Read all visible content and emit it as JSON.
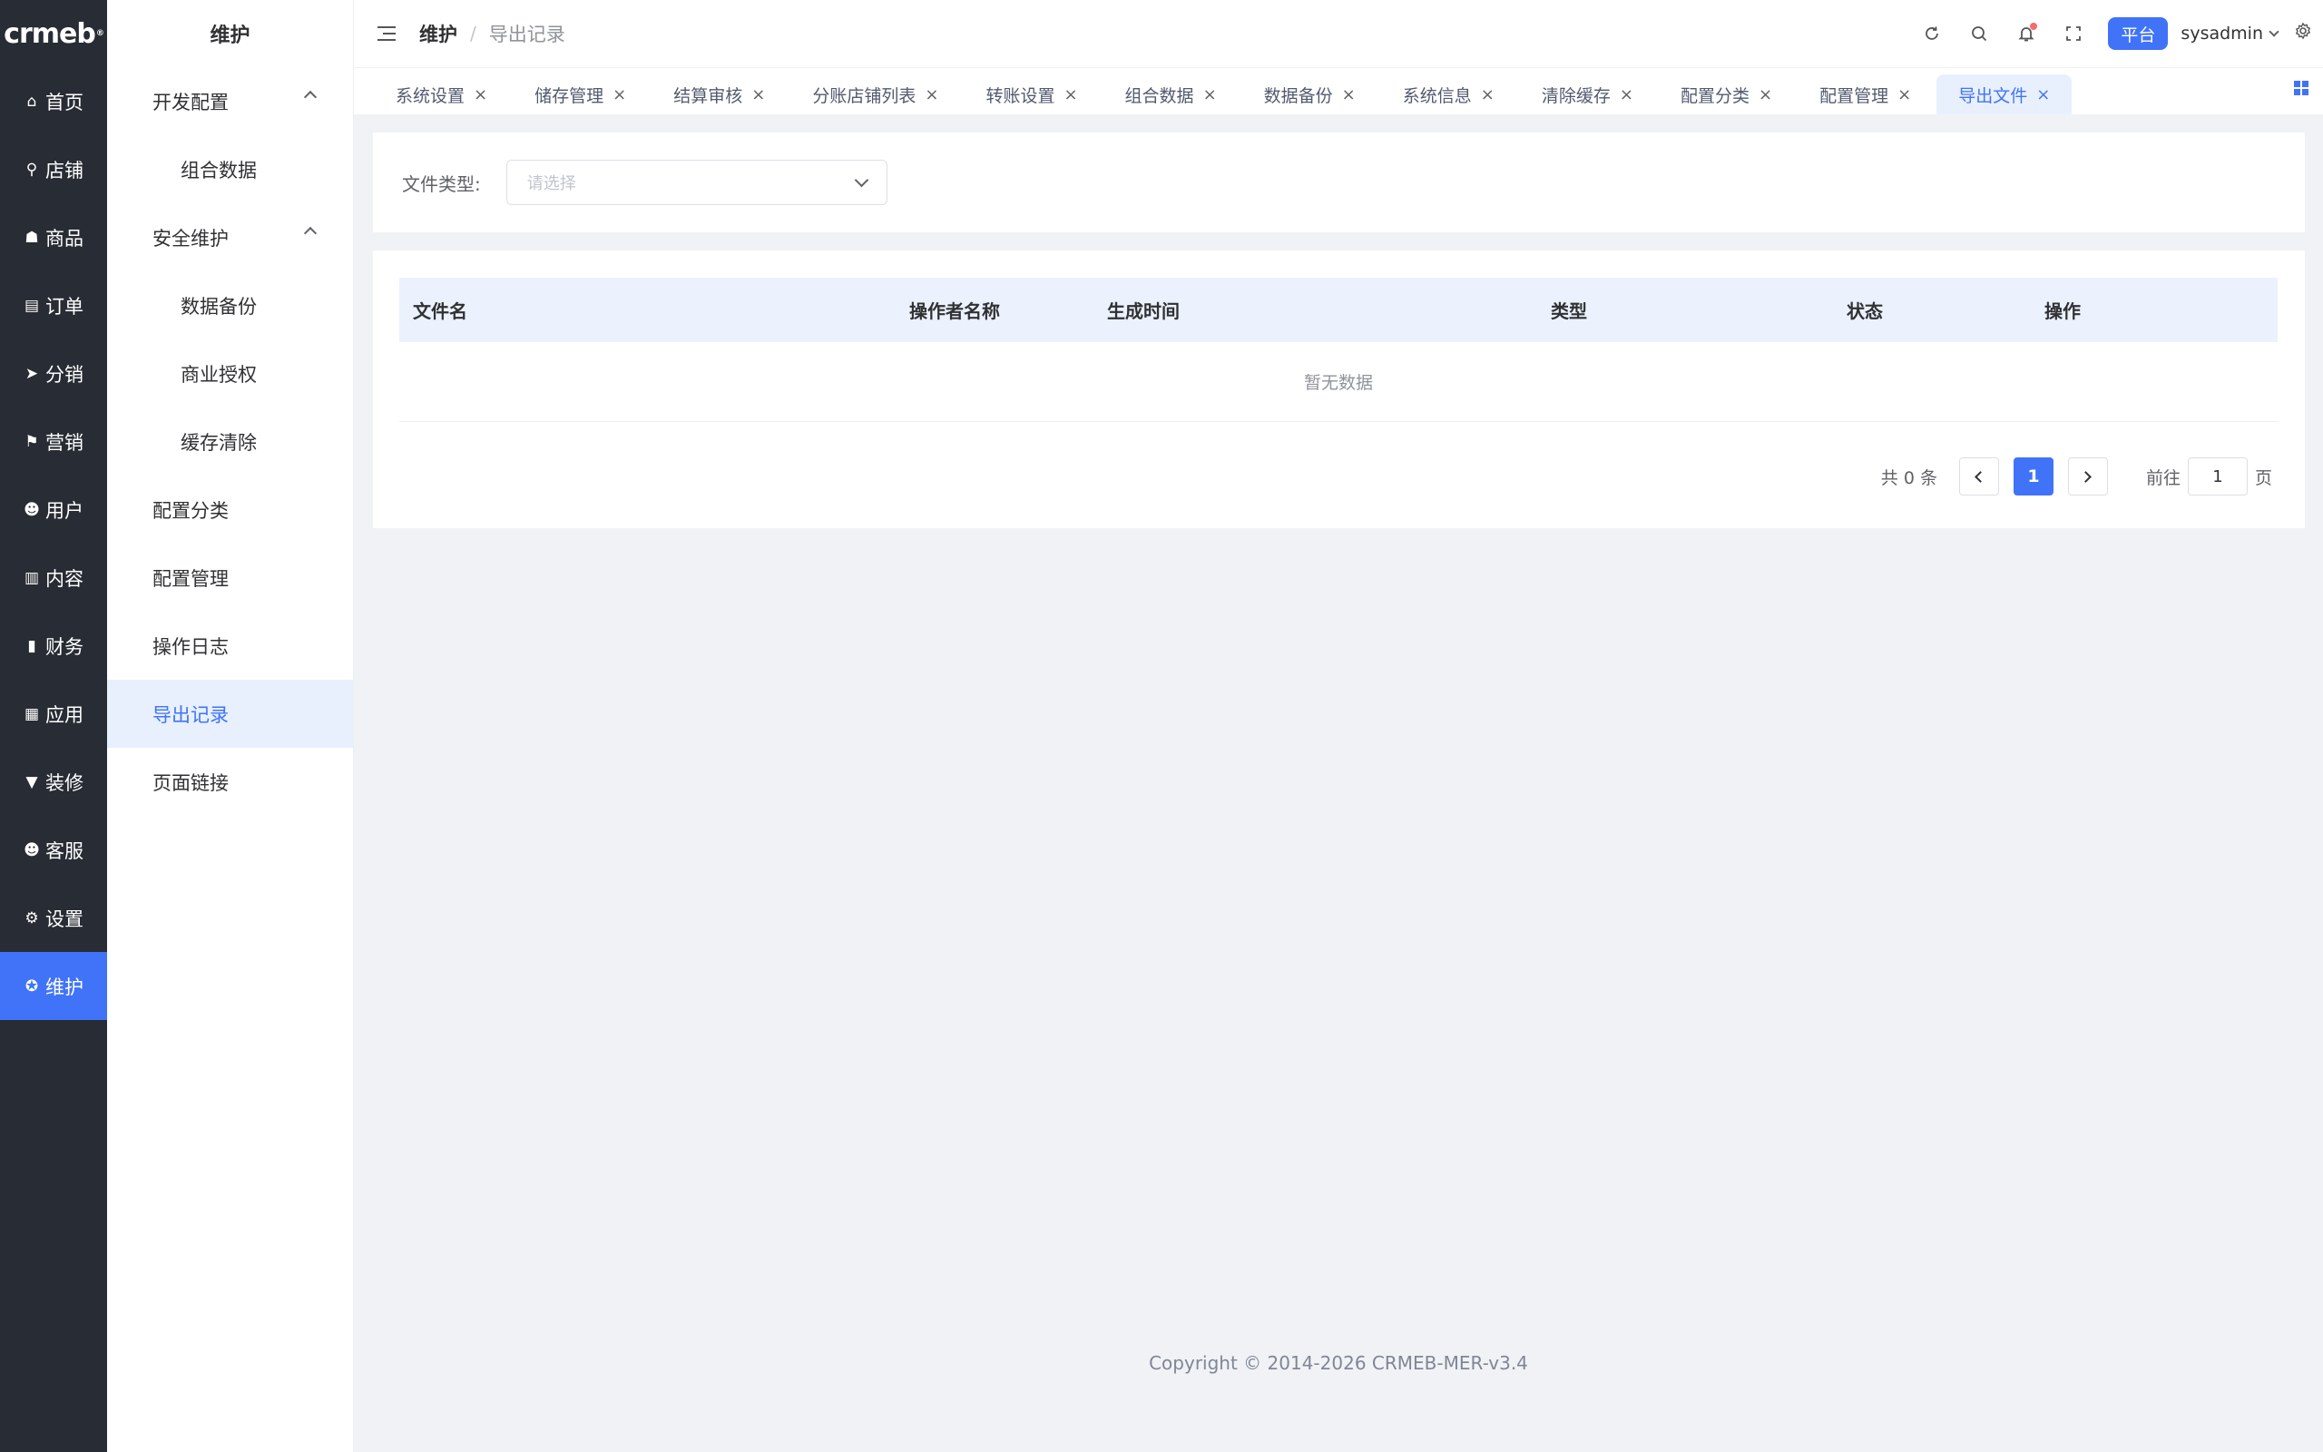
{
  "brand": {
    "logo": "crmeb",
    "logo_mark": "®"
  },
  "nav": {
    "items": [
      {
        "icon": "home-icon",
        "glyph": "⌂",
        "label": "首页"
      },
      {
        "icon": "store-icon",
        "glyph": "⚲",
        "label": "店铺"
      },
      {
        "icon": "bag-icon",
        "glyph": "☗",
        "label": "商品"
      },
      {
        "icon": "clipboard-icon",
        "glyph": "▤",
        "label": "订单"
      },
      {
        "icon": "send-icon",
        "glyph": "➤",
        "label": "分销"
      },
      {
        "icon": "flag-icon",
        "glyph": "⚑",
        "label": "营销"
      },
      {
        "icon": "user-icon",
        "glyph": "☻",
        "label": "用户"
      },
      {
        "icon": "book-icon",
        "glyph": "▥",
        "label": "内容"
      },
      {
        "icon": "bar-chart-icon",
        "glyph": "▮",
        "label": "财务"
      },
      {
        "icon": "apps-icon",
        "glyph": "▦",
        "label": "应用"
      },
      {
        "icon": "brush-icon",
        "glyph": "▼",
        "label": "装修"
      },
      {
        "icon": "service-icon",
        "glyph": "☻",
        "label": "客服"
      },
      {
        "icon": "gear-icon",
        "glyph": "⚙",
        "label": "设置"
      },
      {
        "icon": "maintain-icon",
        "glyph": "✪",
        "label": "维护"
      }
    ],
    "active_index": 13
  },
  "subnav": {
    "title": "维护",
    "items": [
      {
        "label": "开发配置",
        "type": "group"
      },
      {
        "label": "组合数据",
        "type": "child"
      },
      {
        "label": "安全维护",
        "type": "group"
      },
      {
        "label": "数据备份",
        "type": "child"
      },
      {
        "label": "商业授权",
        "type": "child"
      },
      {
        "label": "缓存清除",
        "type": "child"
      },
      {
        "label": "配置分类",
        "type": "item"
      },
      {
        "label": "配置管理",
        "type": "item"
      },
      {
        "label": "操作日志",
        "type": "item"
      },
      {
        "label": "导出记录",
        "type": "item",
        "active": true
      },
      {
        "label": "页面链接",
        "type": "item"
      }
    ]
  },
  "header": {
    "breadcrumb": [
      "维护",
      "导出记录"
    ],
    "separator": "/",
    "platform_badge": "平台",
    "username": "sysadmin",
    "icons": [
      "refresh-icon",
      "search-icon",
      "bell-icon",
      "fullscreen-icon",
      "settings-icon"
    ]
  },
  "tabs": [
    {
      "label": "系统设置"
    },
    {
      "label": "储存管理"
    },
    {
      "label": "结算审核"
    },
    {
      "label": "分账店铺列表"
    },
    {
      "label": "转账设置"
    },
    {
      "label": "组合数据"
    },
    {
      "label": "数据备份"
    },
    {
      "label": "系统信息"
    },
    {
      "label": "清除缓存"
    },
    {
      "label": "配置分类"
    },
    {
      "label": "配置管理"
    },
    {
      "label": "导出文件",
      "active": true
    }
  ],
  "filter": {
    "label": "文件类型:",
    "placeholder": "请选择"
  },
  "table": {
    "columns": [
      "文件名",
      "操作者名称",
      "生成时间",
      "类型",
      "状态",
      "操作"
    ],
    "empty_text": "暂无数据"
  },
  "pagination": {
    "total_text": "共 0 条",
    "current_page": "1",
    "goto_label": "前往",
    "goto_value": "1",
    "page_suffix": "页"
  },
  "footer": {
    "copyright": "Copyright © 2014-2026 CRMEB-MER-v3.4"
  },
  "colors": {
    "accent": "#4073f8",
    "nav_bg": "#282c34",
    "page_bg": "#f0f2f5",
    "table_head_bg": "#ebf2fd"
  }
}
